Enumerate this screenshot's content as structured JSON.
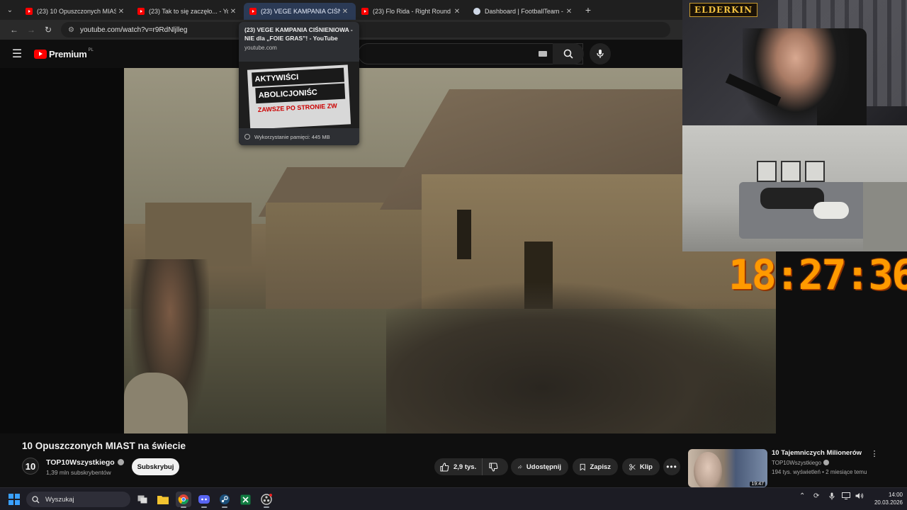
{
  "browser": {
    "tabs": [
      {
        "title": "(23) 10 Opuszczonych MIAST n",
        "active": false,
        "favicon": "youtube-icon"
      },
      {
        "title": "(23) Tak to się zaczęło... - YouTu",
        "active": false,
        "favicon": "youtube-icon"
      },
      {
        "title": "(23) VEGE KAMPANIA CIŚNIENI",
        "active": true,
        "favicon": "youtube-icon"
      },
      {
        "title": "(23) Flo Rida - Right Round (fea",
        "active": false,
        "favicon": "youtube-icon"
      },
      {
        "title": "Dashboard | FootballTeam - On",
        "active": false,
        "favicon": "globe-icon"
      }
    ],
    "url": "youtube.com/watch?v=r9RdNljlleg"
  },
  "hovercard": {
    "title": "(23) VEGE KAMPANIA CIŚNIENIOWA - NIE dla „FOIE GRAS”! - YouTube",
    "host": "youtube.com",
    "memory": "Wykorzystanie pamięci: 445 MB",
    "banner_line1": "AKTYWIŚCI",
    "banner_line2": "ABOLICJONIŚC",
    "banner_line3": "ZAWSZE PO STRONIE ZW"
  },
  "youtube": {
    "logo_text": "Premium",
    "logo_region": "PL"
  },
  "stream": {
    "logo_text": "ELDERKIN",
    "clock": "18:27:36"
  },
  "video": {
    "title": "10 Opuszczonych MIAST na świecie",
    "channel": "TOP10Wszystkiego",
    "channel_avatar": "10",
    "subscribers": "1,39 mln subskrybentów",
    "subscribe_label": "Subskrybuj",
    "likes": "2,9 tys.",
    "share_label": "Udostępnij",
    "save_label": "Zapisz",
    "clip_label": "Klip"
  },
  "recommendation": {
    "title": "10 Tajemniczych Milionerów",
    "channel": "TOP10Wszystkiego",
    "meta": "194 tys. wyświetleń • 2 miesiące temu",
    "duration": "19:47"
  },
  "taskbar": {
    "search_placeholder": "Wyszukaj",
    "time": "14:00",
    "date": "20.03.2026"
  },
  "colors": {
    "youtube_red": "#ff0000",
    "clock_orange": "#ff9a00",
    "active_tab": "#2b3a55"
  }
}
